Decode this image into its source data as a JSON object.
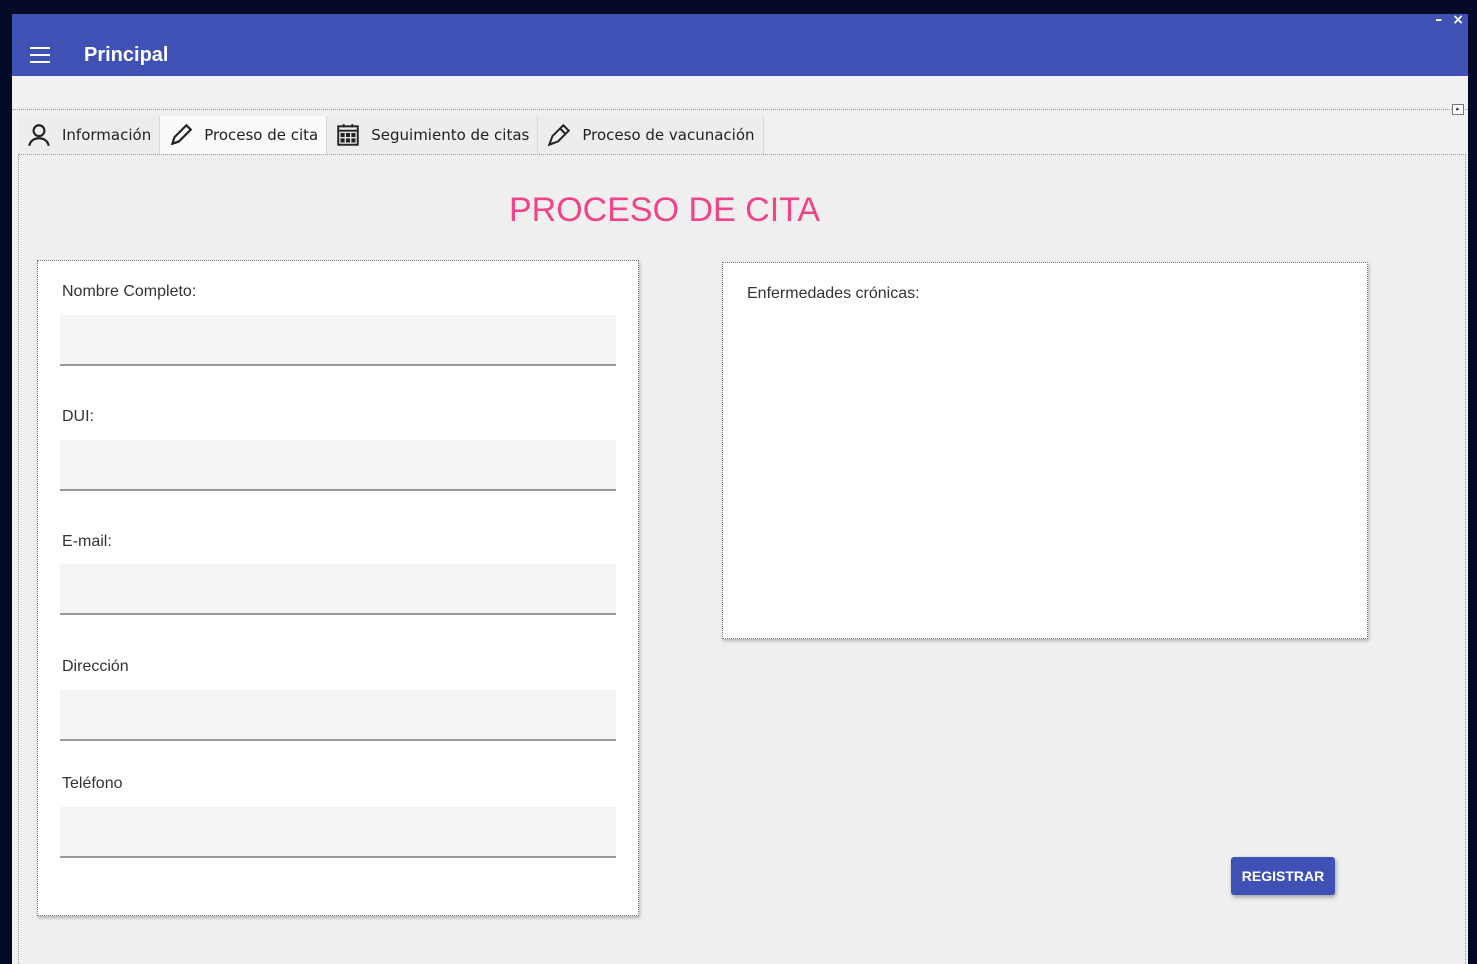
{
  "window": {
    "title": "Principal",
    "minimize_label": "–",
    "close_label": "×",
    "strip_button_label": "▸"
  },
  "tabs": [
    {
      "label": "Información",
      "icon": "user-icon"
    },
    {
      "label": "Proceso de cita",
      "icon": "pencil-icon",
      "active": true
    },
    {
      "label": "Seguimiento de citas",
      "icon": "calendar-icon"
    },
    {
      "label": "Proceso de vacunación",
      "icon": "pen-icon"
    }
  ],
  "form": {
    "title": "PROCESO DE CITA",
    "fields": [
      {
        "label": "Nombre Completo:",
        "value": "",
        "placeholder": ""
      },
      {
        "label": "DUI:",
        "value": "",
        "placeholder": ""
      },
      {
        "label": "E-mail:",
        "value": "",
        "placeholder": ""
      },
      {
        "label": "Dirección",
        "value": "",
        "placeholder": ""
      },
      {
        "label": "Teléfono",
        "value": "",
        "placeholder": ""
      }
    ],
    "chronic_label": "Enfermedades crónicas:",
    "chronic_value": "",
    "submit_label": "REGISTRAR"
  },
  "colors": {
    "header": "#3f51b5",
    "title_accent": "#f0438a",
    "button": "#3f51b5"
  }
}
